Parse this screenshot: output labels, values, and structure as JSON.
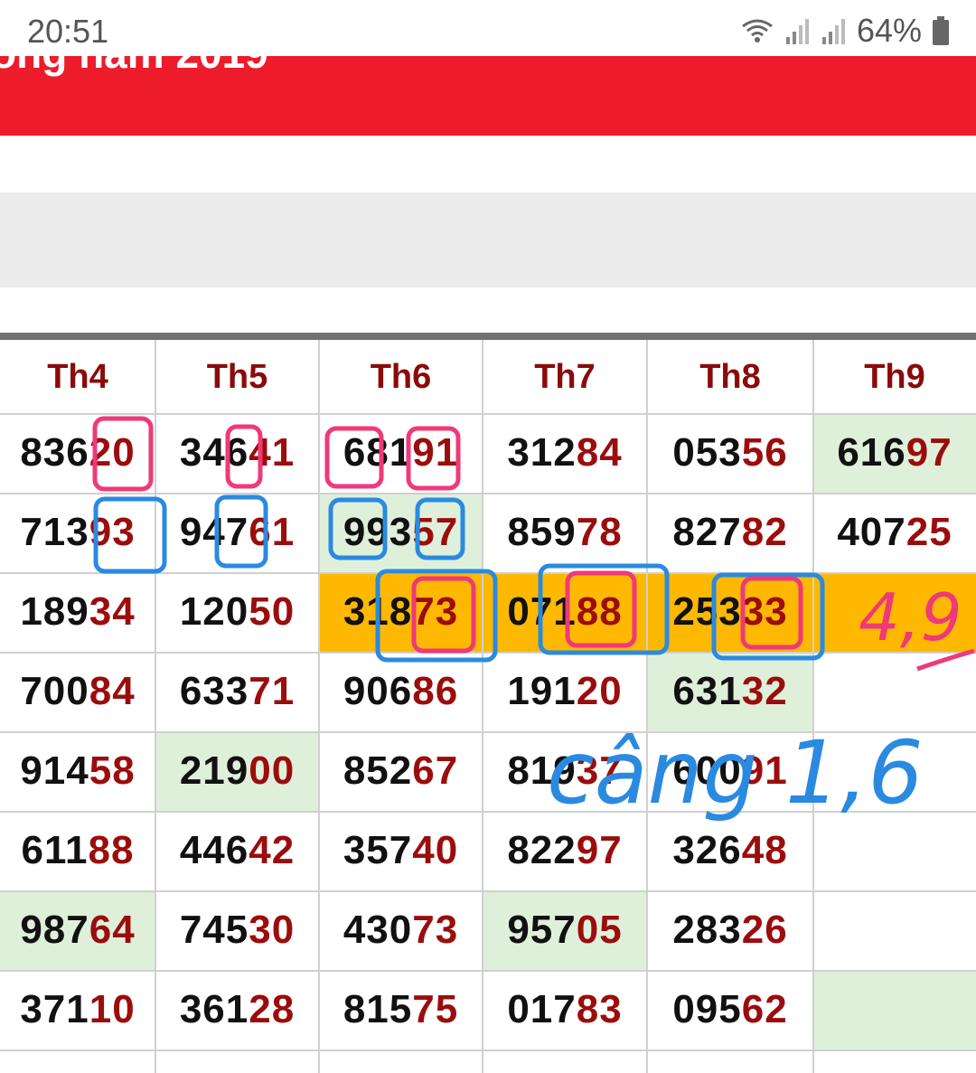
{
  "status": {
    "time": "20:51",
    "battery": "64%"
  },
  "banner": {
    "title": "ổng năm 2019"
  },
  "headers": [
    "Th4",
    "Th5",
    "Th6",
    "Th7",
    "Th8",
    "Th9"
  ],
  "rows": [
    [
      {
        "p": "836",
        "s": "20"
      },
      {
        "p": "346",
        "s": "41"
      },
      {
        "p": "681",
        "s": "91"
      },
      {
        "p": "312",
        "s": "84"
      },
      {
        "p": "053",
        "s": "56"
      },
      {
        "p": "616",
        "s": "97"
      }
    ],
    [
      {
        "p": "713",
        "s": "93"
      },
      {
        "p": "947",
        "s": "61"
      },
      {
        "p": "993",
        "s": "57"
      },
      {
        "p": "859",
        "s": "78"
      },
      {
        "p": "827",
        "s": "82"
      },
      {
        "p": "407",
        "s": "25"
      }
    ],
    [
      {
        "p": "189",
        "s": "34"
      },
      {
        "p": "120",
        "s": "50"
      },
      {
        "p": "318",
        "s": "73"
      },
      {
        "p": "071",
        "s": "88"
      },
      {
        "p": "253",
        "s": "33"
      },
      {
        "p": "",
        "s": ""
      }
    ],
    [
      {
        "p": "700",
        "s": "84"
      },
      {
        "p": "633",
        "s": "71"
      },
      {
        "p": "906",
        "s": "86"
      },
      {
        "p": "191",
        "s": "20"
      },
      {
        "p": "631",
        "s": "32"
      },
      {
        "p": "",
        "s": ""
      }
    ],
    [
      {
        "p": "914",
        "s": "58"
      },
      {
        "p": "219",
        "s": "00"
      },
      {
        "p": "852",
        "s": "67"
      },
      {
        "p": "819",
        "s": "37"
      },
      {
        "p": "600",
        "s": "91"
      },
      {
        "p": "",
        "s": ""
      }
    ],
    [
      {
        "p": "611",
        "s": "88"
      },
      {
        "p": "446",
        "s": "42"
      },
      {
        "p": "357",
        "s": "40"
      },
      {
        "p": "822",
        "s": "97"
      },
      {
        "p": "326",
        "s": "48"
      },
      {
        "p": "",
        "s": ""
      }
    ],
    [
      {
        "p": "987",
        "s": "64"
      },
      {
        "p": "745",
        "s": "30"
      },
      {
        "p": "430",
        "s": "73"
      },
      {
        "p": "957",
        "s": "05"
      },
      {
        "p": "283",
        "s": "26"
      },
      {
        "p": "",
        "s": ""
      }
    ],
    [
      {
        "p": "371",
        "s": "10"
      },
      {
        "p": "361",
        "s": "28"
      },
      {
        "p": "815",
        "s": "75"
      },
      {
        "p": "017",
        "s": "83"
      },
      {
        "p": "095",
        "s": "62"
      },
      {
        "p": "",
        "s": ""
      }
    ]
  ],
  "highlights": {
    "green_cells": [
      [
        0,
        5
      ],
      [
        1,
        2
      ],
      [
        3,
        4
      ],
      [
        4,
        1
      ],
      [
        6,
        0
      ],
      [
        6,
        3
      ],
      [
        7,
        5
      ]
    ],
    "gold_row": 2,
    "gold_from_col": 2
  },
  "annotations": {
    "pink_note": "4,9",
    "blue_note": "câng 1,6",
    "pink_color": "#ee3a78",
    "blue_color": "#2a8ae0"
  }
}
